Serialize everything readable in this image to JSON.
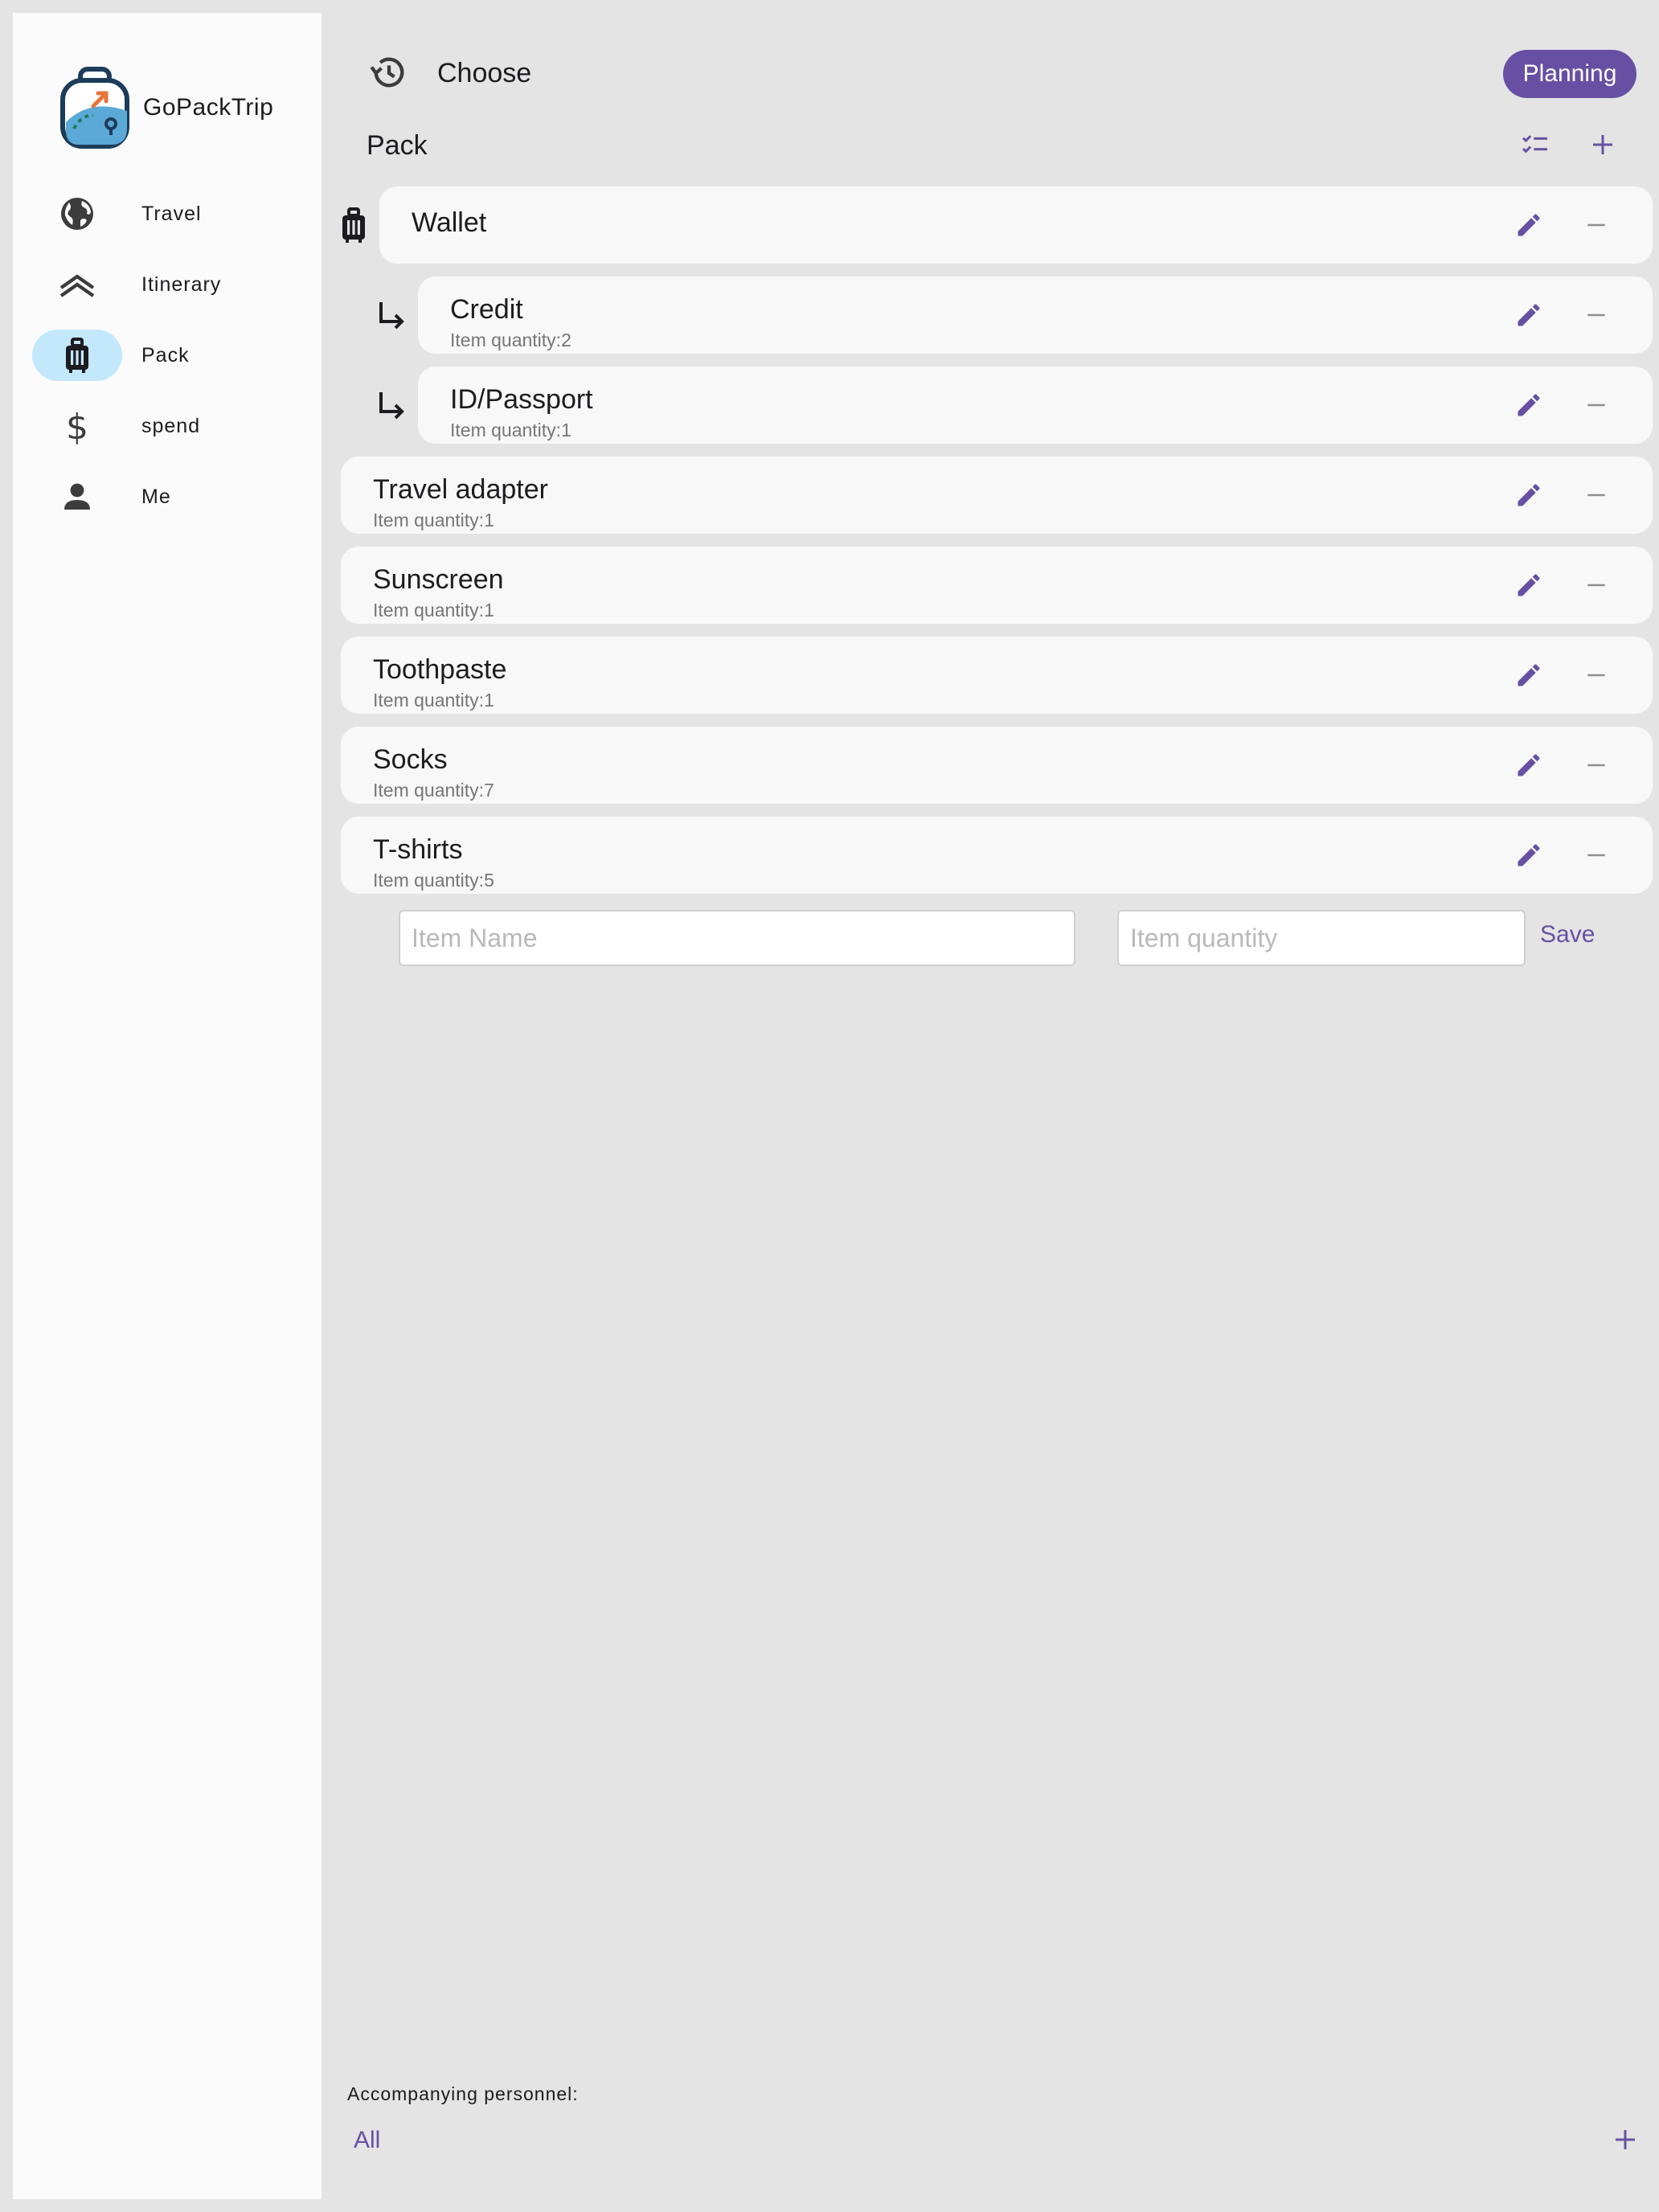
{
  "app": {
    "name": "GoPackTrip"
  },
  "sidebar": {
    "items": [
      {
        "label": "Travel",
        "icon": "globe-icon"
      },
      {
        "label": "Itinerary",
        "icon": "itinerary-icon"
      },
      {
        "label": "Pack",
        "icon": "luggage-icon",
        "active": true
      },
      {
        "label": "spend",
        "icon": "dollar-icon"
      },
      {
        "label": "Me",
        "icon": "person-icon"
      }
    ]
  },
  "header": {
    "title": "Choose",
    "status_chip": "Planning",
    "history_icon": "history-icon"
  },
  "pack": {
    "title": "Pack",
    "group": {
      "name": "Wallet",
      "icon": "luggage-icon"
    },
    "sub_items": [
      {
        "name": "Credit",
        "quantity": "Item quantity:2"
      },
      {
        "name": "ID/Passport",
        "quantity": "Item quantity:1"
      }
    ],
    "items": [
      {
        "name": "Travel adapter",
        "quantity": "Item quantity:1"
      },
      {
        "name": "Sunscreen",
        "quantity": "Item quantity:1"
      },
      {
        "name": "Toothpaste",
        "quantity": "Item quantity:1"
      },
      {
        "name": "Socks",
        "quantity": "Item quantity:7"
      },
      {
        "name": "T-shirts",
        "quantity": "Item quantity:5"
      }
    ]
  },
  "new_item": {
    "name_value": "",
    "name_placeholder": "Item Name",
    "quantity_value": "",
    "quantity_placeholder": "Item quantity",
    "save_label": "Save"
  },
  "personnel": {
    "label": "Accompanying personnel:",
    "selected": "All"
  },
  "colors": {
    "accent": "#6750a4",
    "active_nav": "#c3e8fb",
    "background": "#e4e4e4",
    "card": "#f8f8f8"
  }
}
